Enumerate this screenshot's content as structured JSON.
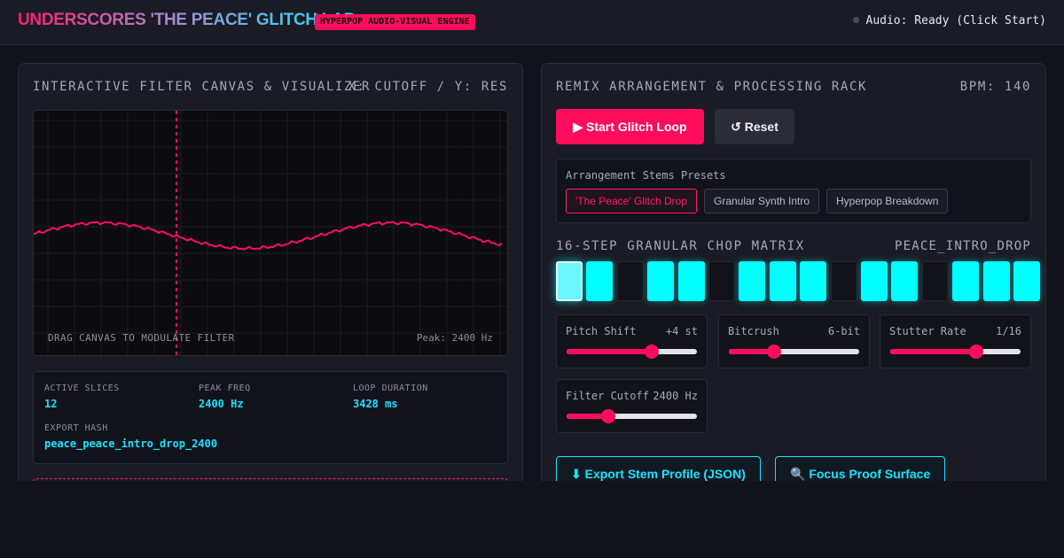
{
  "header": {
    "title": "UNDERSCORES 'THE PEACE' GLITCH LAB",
    "badge": "HYPERPOP AUDIO-VISUAL ENGINE",
    "audio_status": "Audio: Ready (Click Start)"
  },
  "filter_panel": {
    "title": "INTERACTIVE FILTER CANVAS & VISUALIZER",
    "axis_hint": "X: CUTOFF / Y: RES",
    "canvas_hint": "DRAG CANVAS TO MODULATE FILTER",
    "peak_label": "Peak: 2400 Hz",
    "cursor_position": 0.3
  },
  "stats": {
    "active_slices": {
      "label": "ACTIVE SLICES",
      "value": "12"
    },
    "peak_freq": {
      "label": "PEAK FREQ",
      "value": "2400 Hz"
    },
    "loop_duration": {
      "label": "LOOP DURATION",
      "value": "3428 ms"
    },
    "export_hash": {
      "label": "EXPORT HASH",
      "value": "peace_peace_intro_drop_2400"
    }
  },
  "remix_panel": {
    "title": "REMIX ARRANGEMENT & PROCESSING RACK",
    "bpm": "BPM: 140",
    "start_label": "▶ Start Glitch Loop",
    "reset_label": "↺ Reset"
  },
  "presets": {
    "title": "Arrangement Stems Presets",
    "items": [
      {
        "label": "'The Peace' Glitch Drop",
        "active": true
      },
      {
        "label": "Granular Synth Intro",
        "active": false
      },
      {
        "label": "Hyperpop Breakdown",
        "active": false
      }
    ]
  },
  "matrix": {
    "title": "16-STEP GRANULAR CHOP MATRIX",
    "pattern_name": "PEACE_INTRO_DROP",
    "steps": [
      1,
      1,
      0,
      1,
      1,
      0,
      1,
      1,
      1,
      0,
      1,
      1,
      0,
      1,
      1,
      1
    ],
    "current_step": 0,
    "on_color": "#00ffff"
  },
  "knobs": [
    {
      "label": "Pitch Shift",
      "value": "+4 st",
      "level": 0.65
    },
    {
      "label": "Bitcrush",
      "value": "6-bit",
      "level": 0.35
    },
    {
      "label": "Stutter Rate",
      "value": "1/16",
      "level": 0.66
    },
    {
      "label": "Filter Cutoff",
      "value": "2400 Hz",
      "level": 0.32
    }
  ],
  "actions": {
    "export_label": "⬇ Export Stem Profile (JSON)",
    "focus_label": "🔍 Focus Proof Surface"
  },
  "colors": {
    "accent": "#ff0d5c",
    "cyan": "#19e3ff",
    "background": "#11121a",
    "panel": "#1a1b24"
  }
}
